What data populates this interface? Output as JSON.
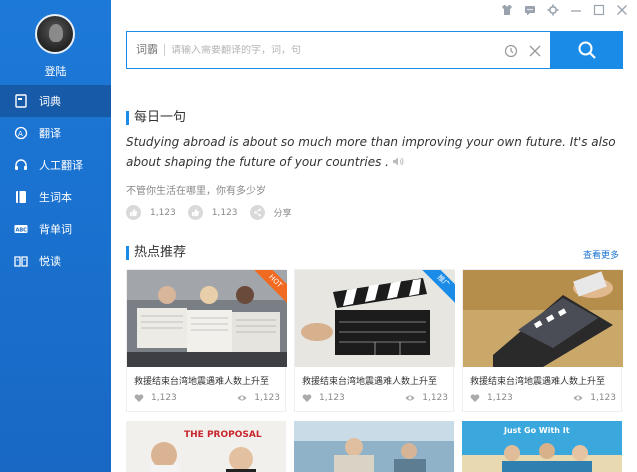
{
  "sidebar": {
    "login_label": "登陆",
    "items": [
      {
        "label": "词典",
        "icon": "dictionary-icon",
        "active": true
      },
      {
        "label": "翻译",
        "icon": "translate-icon",
        "active": false
      },
      {
        "label": "人工翻译",
        "icon": "headset-icon",
        "active": false
      },
      {
        "label": "生词本",
        "icon": "wordbook-icon",
        "active": false
      },
      {
        "label": "背单词",
        "icon": "abc-icon",
        "active": false
      },
      {
        "label": "悦读",
        "icon": "reading-icon",
        "active": false
      }
    ]
  },
  "titlebar": {
    "icons": [
      "shirt-icon",
      "message-icon",
      "settings-icon",
      "minimize-icon",
      "maximize-icon",
      "close-icon"
    ]
  },
  "search": {
    "prefix": "词霸",
    "placeholder": "请输入需要翻译的字，词，句"
  },
  "daily": {
    "title": "每日一句",
    "sentence_en": "Studying abroad is about so much more than improving your own future. It's also about shaping the future of your countries .",
    "sentence_cn": "不管你生活在哪里，你有多少岁",
    "likes": "1,123",
    "comments": "1,123",
    "share": "分享"
  },
  "hot": {
    "title": "热点推荐",
    "more": "查看更多",
    "cards": [
      {
        "caption": "救援结束台湾地震遇难人数上升至",
        "likes": "1,123",
        "views": "1,123",
        "badge": "HOT"
      },
      {
        "caption": "救援结束台湾地震遇难人数上升至",
        "likes": "1,123",
        "views": "1,123",
        "badge": "推广"
      },
      {
        "caption": "救援结束台湾地震遇难人数上升至",
        "likes": "1,123",
        "views": "1,123",
        "badge": ""
      }
    ],
    "second_row_labels": [
      "THE PROPOSAL",
      "",
      "Just Go With It"
    ]
  },
  "colors": {
    "accent": "#1a8ce8",
    "sidebar": "#1d79d8",
    "hot_badge": "#f06a22"
  }
}
